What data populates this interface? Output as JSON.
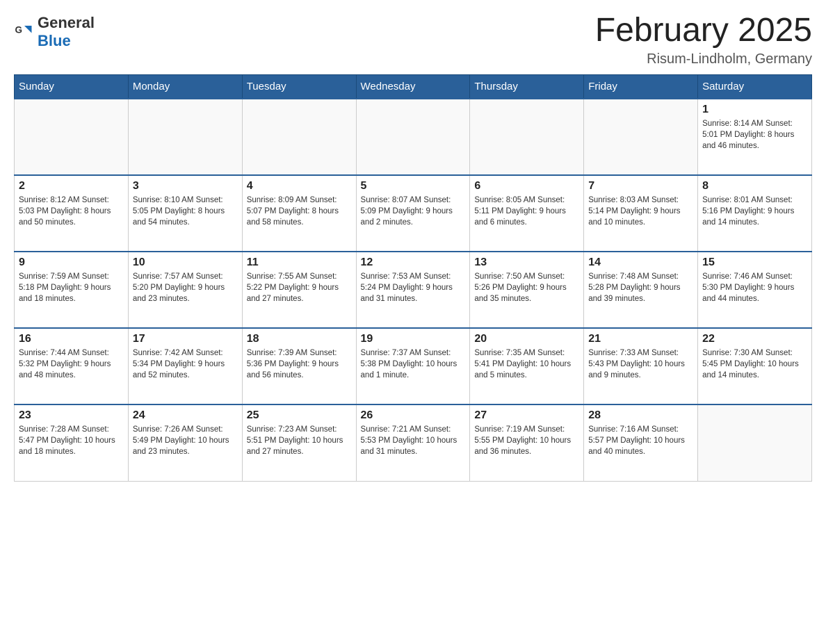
{
  "logo": {
    "text_general": "General",
    "text_blue": "Blue"
  },
  "title": "February 2025",
  "location": "Risum-Lindholm, Germany",
  "days_of_week": [
    "Sunday",
    "Monday",
    "Tuesday",
    "Wednesday",
    "Thursday",
    "Friday",
    "Saturday"
  ],
  "weeks": [
    [
      {
        "day": "",
        "info": ""
      },
      {
        "day": "",
        "info": ""
      },
      {
        "day": "",
        "info": ""
      },
      {
        "day": "",
        "info": ""
      },
      {
        "day": "",
        "info": ""
      },
      {
        "day": "",
        "info": ""
      },
      {
        "day": "1",
        "info": "Sunrise: 8:14 AM\nSunset: 5:01 PM\nDaylight: 8 hours and 46 minutes."
      }
    ],
    [
      {
        "day": "2",
        "info": "Sunrise: 8:12 AM\nSunset: 5:03 PM\nDaylight: 8 hours and 50 minutes."
      },
      {
        "day": "3",
        "info": "Sunrise: 8:10 AM\nSunset: 5:05 PM\nDaylight: 8 hours and 54 minutes."
      },
      {
        "day": "4",
        "info": "Sunrise: 8:09 AM\nSunset: 5:07 PM\nDaylight: 8 hours and 58 minutes."
      },
      {
        "day": "5",
        "info": "Sunrise: 8:07 AM\nSunset: 5:09 PM\nDaylight: 9 hours and 2 minutes."
      },
      {
        "day": "6",
        "info": "Sunrise: 8:05 AM\nSunset: 5:11 PM\nDaylight: 9 hours and 6 minutes."
      },
      {
        "day": "7",
        "info": "Sunrise: 8:03 AM\nSunset: 5:14 PM\nDaylight: 9 hours and 10 minutes."
      },
      {
        "day": "8",
        "info": "Sunrise: 8:01 AM\nSunset: 5:16 PM\nDaylight: 9 hours and 14 minutes."
      }
    ],
    [
      {
        "day": "9",
        "info": "Sunrise: 7:59 AM\nSunset: 5:18 PM\nDaylight: 9 hours and 18 minutes."
      },
      {
        "day": "10",
        "info": "Sunrise: 7:57 AM\nSunset: 5:20 PM\nDaylight: 9 hours and 23 minutes."
      },
      {
        "day": "11",
        "info": "Sunrise: 7:55 AM\nSunset: 5:22 PM\nDaylight: 9 hours and 27 minutes."
      },
      {
        "day": "12",
        "info": "Sunrise: 7:53 AM\nSunset: 5:24 PM\nDaylight: 9 hours and 31 minutes."
      },
      {
        "day": "13",
        "info": "Sunrise: 7:50 AM\nSunset: 5:26 PM\nDaylight: 9 hours and 35 minutes."
      },
      {
        "day": "14",
        "info": "Sunrise: 7:48 AM\nSunset: 5:28 PM\nDaylight: 9 hours and 39 minutes."
      },
      {
        "day": "15",
        "info": "Sunrise: 7:46 AM\nSunset: 5:30 PM\nDaylight: 9 hours and 44 minutes."
      }
    ],
    [
      {
        "day": "16",
        "info": "Sunrise: 7:44 AM\nSunset: 5:32 PM\nDaylight: 9 hours and 48 minutes."
      },
      {
        "day": "17",
        "info": "Sunrise: 7:42 AM\nSunset: 5:34 PM\nDaylight: 9 hours and 52 minutes."
      },
      {
        "day": "18",
        "info": "Sunrise: 7:39 AM\nSunset: 5:36 PM\nDaylight: 9 hours and 56 minutes."
      },
      {
        "day": "19",
        "info": "Sunrise: 7:37 AM\nSunset: 5:38 PM\nDaylight: 10 hours and 1 minute."
      },
      {
        "day": "20",
        "info": "Sunrise: 7:35 AM\nSunset: 5:41 PM\nDaylight: 10 hours and 5 minutes."
      },
      {
        "day": "21",
        "info": "Sunrise: 7:33 AM\nSunset: 5:43 PM\nDaylight: 10 hours and 9 minutes."
      },
      {
        "day": "22",
        "info": "Sunrise: 7:30 AM\nSunset: 5:45 PM\nDaylight: 10 hours and 14 minutes."
      }
    ],
    [
      {
        "day": "23",
        "info": "Sunrise: 7:28 AM\nSunset: 5:47 PM\nDaylight: 10 hours and 18 minutes."
      },
      {
        "day": "24",
        "info": "Sunrise: 7:26 AM\nSunset: 5:49 PM\nDaylight: 10 hours and 23 minutes."
      },
      {
        "day": "25",
        "info": "Sunrise: 7:23 AM\nSunset: 5:51 PM\nDaylight: 10 hours and 27 minutes."
      },
      {
        "day": "26",
        "info": "Sunrise: 7:21 AM\nSunset: 5:53 PM\nDaylight: 10 hours and 31 minutes."
      },
      {
        "day": "27",
        "info": "Sunrise: 7:19 AM\nSunset: 5:55 PM\nDaylight: 10 hours and 36 minutes."
      },
      {
        "day": "28",
        "info": "Sunrise: 7:16 AM\nSunset: 5:57 PM\nDaylight: 10 hours and 40 minutes."
      },
      {
        "day": "",
        "info": ""
      }
    ]
  ]
}
